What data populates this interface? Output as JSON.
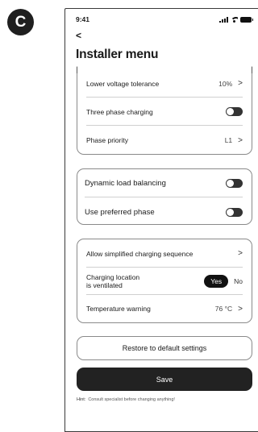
{
  "badge": {
    "letter": "C"
  },
  "status_bar": {
    "time": "9:41"
  },
  "header": {
    "back_label": "<",
    "title": "Installer menu"
  },
  "group1": {
    "items": [
      {
        "label": "Lower voltage tolerance",
        "value": "10%"
      },
      {
        "label": "Three phase charging",
        "toggle_on": false
      },
      {
        "label": "Phase priority",
        "value": "L1"
      }
    ]
  },
  "group2": {
    "items": [
      {
        "label": "Dynamic load balancing",
        "toggle_on": false
      },
      {
        "label": "Use preferred phase",
        "toggle_on": false
      }
    ]
  },
  "group3": {
    "items": [
      {
        "label": "Allow simplified charging sequence"
      },
      {
        "label_line1": "Charging location",
        "label_line2": "is ventilated",
        "options": [
          "Yes",
          "No"
        ],
        "selected": "Yes"
      },
      {
        "label": "Temperature warning",
        "value": "76 °C"
      }
    ]
  },
  "actions": {
    "restore_label": "Restore to default settings",
    "save_label": "Save"
  },
  "hint": {
    "prefix": "Hint:",
    "text": "Consult specialist before changing anything!"
  },
  "colors": {
    "primary": "#222222",
    "border": "#8a8a8a",
    "divider": "#d0d0d0"
  }
}
